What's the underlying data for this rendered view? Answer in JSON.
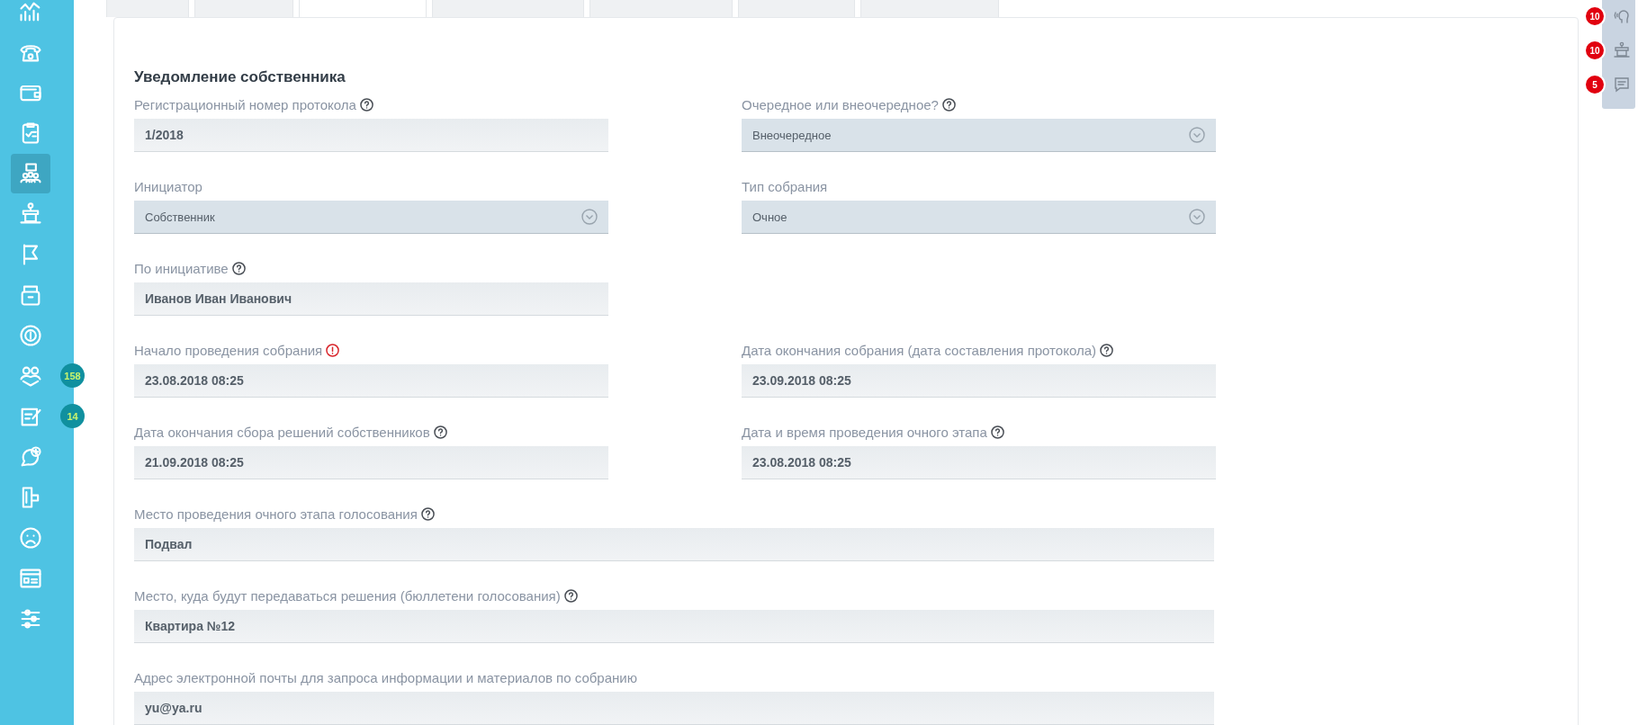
{
  "sidebar": {
    "items": [
      {
        "selected": false
      },
      {
        "selected": false
      },
      {
        "selected": false
      },
      {
        "selected": false
      },
      {
        "selected": true
      },
      {
        "selected": false
      },
      {
        "selected": false
      },
      {
        "selected": false
      },
      {
        "selected": false
      },
      {
        "selected": false,
        "badge": "158"
      },
      {
        "selected": false,
        "badge": "14"
      },
      {
        "selected": false
      },
      {
        "selected": false
      },
      {
        "selected": false
      },
      {
        "selected": false
      },
      {
        "selected": false
      }
    ]
  },
  "tabs": [
    {
      "selected": false
    },
    {
      "selected": false
    },
    {
      "selected": true
    },
    {
      "selected": false
    },
    {
      "selected": false
    },
    {
      "selected": false
    },
    {
      "selected": false
    }
  ],
  "form": {
    "title": "Уведомление собственника",
    "grid_rows": [
      [
        {
          "label": "Регистрационный номер протокола",
          "help": true,
          "error": false,
          "kind": "text",
          "value": "1/2018"
        },
        {
          "label": "Очередное или внеочередное?",
          "help": true,
          "error": false,
          "kind": "select",
          "value": "Внеочередное"
        }
      ],
      [
        {
          "label": "Инициатор",
          "help": false,
          "error": false,
          "kind": "select",
          "value": "Собственник"
        },
        {
          "label": "Тип собрания",
          "help": false,
          "error": false,
          "kind": "select",
          "value": "Очное"
        }
      ],
      [
        {
          "label": "По инициативе",
          "help": true,
          "error": false,
          "kind": "text",
          "value": "Иванов Иван Иванович"
        }
      ],
      [
        {
          "label": "Начало проведения собрания",
          "help": false,
          "error": true,
          "kind": "text",
          "value": "23.08.2018 08:25"
        },
        {
          "label": "Дата окончания собрания (дата составления протокола)",
          "help": true,
          "error": false,
          "kind": "text",
          "value": "23.09.2018 08:25"
        }
      ],
      [
        {
          "label": "Дата окончания сбора решений собственников",
          "help": true,
          "error": false,
          "kind": "text",
          "value": "21.09.2018 08:25"
        },
        {
          "label": "Дата и время проведения очного этапа",
          "help": true,
          "error": false,
          "kind": "text",
          "value": "23.08.2018 08:25"
        }
      ]
    ],
    "wide_fields": [
      {
        "label": "Место проведения очного этапа голосования",
        "help": true,
        "error": false,
        "kind": "text",
        "value": "Подвал"
      },
      {
        "label": "Место, куда будут передаваться решения (бюллетени голосования)",
        "help": true,
        "error": false,
        "kind": "text",
        "value": "Квартира №12"
      },
      {
        "label": "Адрес электронной почты для запроса информации и материалов по собранию",
        "help": false,
        "error": false,
        "kind": "text",
        "value": "yu@ya.ru"
      }
    ]
  },
  "notifications": [
    {
      "count": "10"
    },
    {
      "count": "10"
    },
    {
      "count": "5"
    }
  ]
}
